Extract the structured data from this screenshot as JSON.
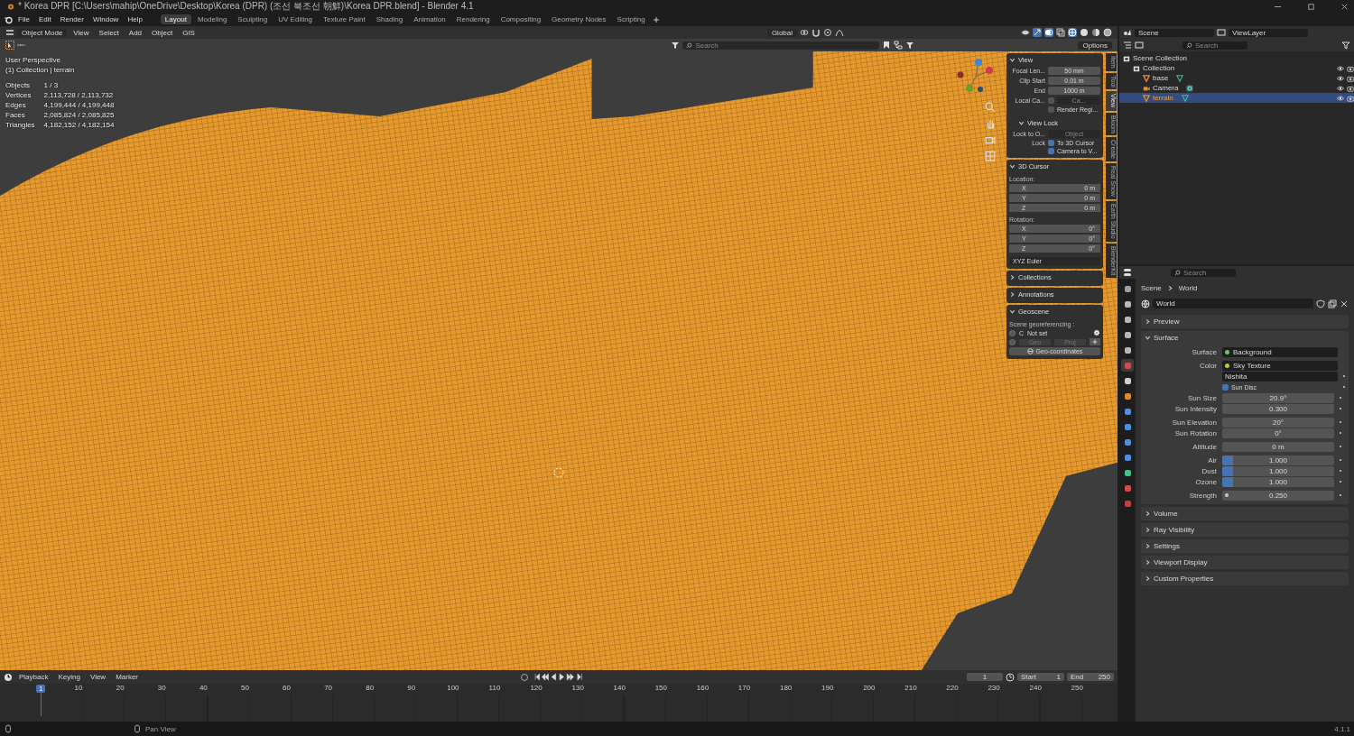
{
  "window": {
    "title": "* Korea DPR [C:\\Users\\mahip\\OneDrive\\Desktop\\Korea (DPR) (조선 북조선 朝鮮)\\Korea DPR.blend] - Blender 4.1"
  },
  "menu": [
    "File",
    "Edit",
    "Render",
    "Window",
    "Help"
  ],
  "workspaces": [
    {
      "label": "Layout",
      "selected": true
    },
    {
      "label": "Modeling",
      "selected": false
    },
    {
      "label": "Sculpting",
      "selected": false
    },
    {
      "label": "UV Editing",
      "selected": false
    },
    {
      "label": "Texture Paint",
      "selected": false
    },
    {
      "label": "Shading",
      "selected": false
    },
    {
      "label": "Animation",
      "selected": false
    },
    {
      "label": "Rendering",
      "selected": false
    },
    {
      "label": "Compositing",
      "selected": false
    },
    {
      "label": "Geometry Nodes",
      "selected": false
    },
    {
      "label": "Scripting",
      "selected": false
    }
  ],
  "viewport_header": {
    "mode": "Object Mode",
    "menus": [
      "View",
      "Select",
      "Add",
      "Object",
      "GIS"
    ],
    "orientation": "Global",
    "search_placeholder": "Search",
    "options": "Options"
  },
  "viewport_overlay": {
    "view_name": "User Perspective",
    "context": "(1) Collection | terrain",
    "stats": [
      {
        "label": "Objects",
        "value": "1 / 3"
      },
      {
        "label": "Vertices",
        "value": "2,113,728 / 2,113,732"
      },
      {
        "label": "Edges",
        "value": "4,199,444 / 4,199,448"
      },
      {
        "label": "Faces",
        "value": "2,085,824 / 2,085,825"
      },
      {
        "label": "Triangles",
        "value": "4,182,152 / 4,182,154"
      }
    ]
  },
  "sidebar_tabs": [
    {
      "label": "Item",
      "selected": false
    },
    {
      "label": "Tool",
      "selected": false
    },
    {
      "label": "View",
      "selected": true
    },
    {
      "label": "Bloom",
      "selected": false
    },
    {
      "label": "Create",
      "selected": false
    },
    {
      "label": "Real Snow",
      "selected": false
    },
    {
      "label": "Earth Studio",
      "selected": false
    },
    {
      "label": "BlenderKit",
      "selected": false
    }
  ],
  "view_panel": {
    "title": "View",
    "fields": [
      {
        "label": "Focal Len...",
        "value": "50 mm"
      },
      {
        "label": "Clip Start",
        "value": "0.01 m"
      },
      {
        "label": "End",
        "value": "1000 m"
      }
    ],
    "local_camera": {
      "label": "Local Ca...",
      "checked": false,
      "placeholder": "Ca..."
    },
    "render_region": {
      "label": "Render Regi...",
      "checked": false
    },
    "view_lock": {
      "title": "View Lock",
      "lock_to_label": "Lock to O...",
      "lock_to_placeholder": "Object",
      "lock_label": "Lock",
      "options": [
        {
          "label": "To 3D Cursor",
          "checked": true
        },
        {
          "label": "Camera to V...",
          "checked": true
        }
      ]
    }
  },
  "cursor_panel": {
    "title": "3D Cursor",
    "location_label": "Location:",
    "location": [
      {
        "axis": "X",
        "value": "0 m"
      },
      {
        "axis": "Y",
        "value": "0 m"
      },
      {
        "axis": "Z",
        "value": "0 m"
      }
    ],
    "rotation_label": "Rotation:",
    "rotation": [
      {
        "axis": "X",
        "value": "0°"
      },
      {
        "axis": "Y",
        "value": "0°"
      },
      {
        "axis": "Z",
        "value": "0°"
      }
    ],
    "rotation_mode": "XYZ Euler"
  },
  "collapsed_panels": [
    "Collections",
    "Annotations"
  ],
  "geoscene": {
    "title": "Geoscene",
    "label": "Scene georeferencing :",
    "crs_letter": "C",
    "crs_value": "Not set",
    "geo": "Geo",
    "proj": "Proj",
    "button": "Geo-coordinates"
  },
  "outliner": {
    "scene": "Scene",
    "view_layer": "ViewLayer",
    "search_placeholder": "Search",
    "tree": [
      {
        "label": "Scene Collection",
        "kind": "scene_collection",
        "selected": false,
        "children": [
          {
            "label": "Collection",
            "kind": "collection",
            "selected": false,
            "children": [
              {
                "label": "base",
                "kind": "mesh",
                "selected": false
              },
              {
                "label": "Camera",
                "kind": "camera",
                "selected": false
              },
              {
                "label": "terrain",
                "kind": "mesh",
                "selected": true
              }
            ]
          }
        ]
      }
    ]
  },
  "properties": {
    "search_placeholder": "Search",
    "breadcrumb": [
      "Scene",
      "World"
    ],
    "world_name": "World",
    "tabs": [
      {
        "kind": "tool",
        "selected": false
      },
      {
        "kind": "render",
        "selected": false
      },
      {
        "kind": "output",
        "selected": false
      },
      {
        "kind": "view_layer",
        "selected": false
      },
      {
        "kind": "scene",
        "selected": false
      },
      {
        "kind": "world",
        "selected": true
      },
      {
        "kind": "collection",
        "selected": false
      },
      {
        "kind": "object",
        "selected": false
      },
      {
        "kind": "modifiers",
        "selected": false
      },
      {
        "kind": "particles",
        "selected": false
      },
      {
        "kind": "physics",
        "selected": false
      },
      {
        "kind": "constraints",
        "selected": false
      },
      {
        "kind": "data",
        "selected": false
      },
      {
        "kind": "material",
        "selected": false
      },
      {
        "kind": "texture",
        "selected": false
      }
    ],
    "panels_before": [
      {
        "title": "Preview"
      }
    ],
    "surface": {
      "title": "Surface",
      "rows": [
        {
          "kind": "socket",
          "label": "Surface",
          "value": "Background",
          "color": "#6ec46e"
        },
        {
          "kind": "socket",
          "label": "Color",
          "value": "Sky Texture",
          "color": "#c7c729"
        },
        {
          "kind": "dropdown",
          "value": "Nishita"
        },
        {
          "kind": "checkbox",
          "label": "Sun Disc",
          "checked": true
        },
        {
          "kind": "number",
          "label": "Sun Size",
          "value": "20.9°"
        },
        {
          "kind": "number",
          "label": "Sun Intensity",
          "value": "0.300"
        },
        {
          "kind": "number",
          "label": "Sun Elevation",
          "value": "20°"
        },
        {
          "kind": "number",
          "label": "Sun Rotation",
          "value": "0°"
        },
        {
          "kind": "number",
          "label": "Altitude",
          "value": "0 m"
        },
        {
          "kind": "slider",
          "label": "Air",
          "value": "1.000",
          "level": 0.1
        },
        {
          "kind": "slider",
          "label": "Dust",
          "value": "1.000",
          "level": 0.1
        },
        {
          "kind": "slider",
          "label": "Ozone",
          "value": "1.000",
          "level": 0.1
        },
        {
          "kind": "input",
          "label": "Strength",
          "value": "0.250"
        }
      ]
    },
    "panels_after": [
      {
        "title": "Volume"
      },
      {
        "title": "Ray Visibility"
      },
      {
        "title": "Settings"
      },
      {
        "title": "Viewport Display"
      },
      {
        "title": "Custom Properties"
      }
    ]
  },
  "timeline": {
    "menus": [
      "Playback",
      "Keying",
      "View",
      "Marker"
    ],
    "current_frame": "1",
    "start_label": "Start",
    "start": "1",
    "end_label": "End",
    "end": "250",
    "marker": "1",
    "ticks": [
      "10",
      "20",
      "30",
      "40",
      "50",
      "60",
      "70",
      "80",
      "90",
      "100",
      "110",
      "120",
      "130",
      "140",
      "150",
      "160",
      "170",
      "180",
      "190",
      "200",
      "210",
      "220",
      "230",
      "240",
      "250"
    ]
  },
  "status_bar": {
    "hint": "Pan View",
    "version": "4.1.1"
  }
}
